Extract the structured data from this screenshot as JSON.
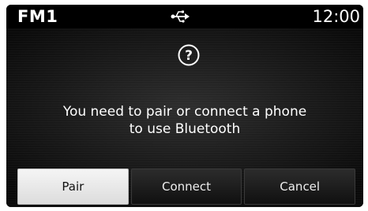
{
  "status_bar": {
    "source": "FM1",
    "usb_icon": "usb-icon",
    "clock": "12:00"
  },
  "dialog": {
    "icon": "question-circle-icon",
    "message_line1": "You need to pair or connect a phone",
    "message_line2": "to use Bluetooth",
    "buttons": [
      {
        "label": "Pair",
        "selected": true
      },
      {
        "label": "Connect",
        "selected": false
      },
      {
        "label": "Cancel",
        "selected": false
      }
    ]
  }
}
